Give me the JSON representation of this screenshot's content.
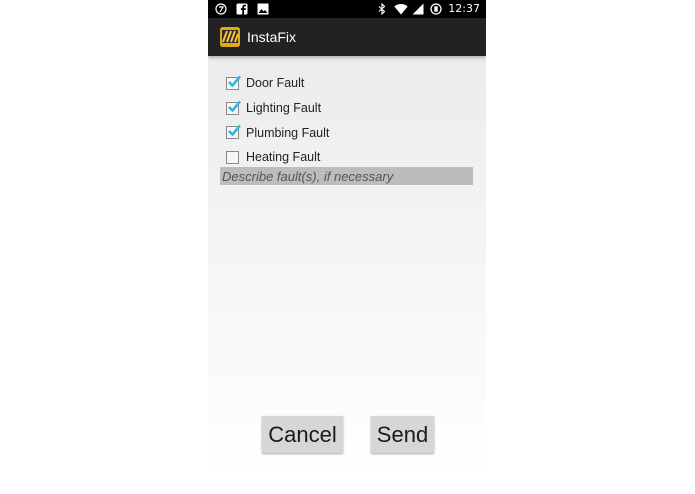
{
  "status_bar": {
    "time": "12:37",
    "left_icons": [
      "notification-icon",
      "facebook-icon",
      "image-icon"
    ],
    "right_icons": [
      "bluetooth-icon",
      "wifi-icon",
      "signal-icon",
      "battery-icon"
    ]
  },
  "action_bar": {
    "app_icon": "app-logo-icon",
    "title": "InstaFix"
  },
  "faults": [
    {
      "label": "Door Fault",
      "checked": true
    },
    {
      "label": "Lighting Fault",
      "checked": true
    },
    {
      "label": "Plumbing Fault",
      "checked": true
    },
    {
      "label": "Heating Fault",
      "checked": false
    }
  ],
  "description": {
    "value": "",
    "placeholder": "Describe fault(s), if necessary"
  },
  "buttons": {
    "cancel_label": "Cancel",
    "send_label": "Send"
  },
  "colors": {
    "checkmark": "#33b5e5",
    "action_bar": "#222222",
    "status_bar": "#000000",
    "app_icon": "#e3a717"
  }
}
